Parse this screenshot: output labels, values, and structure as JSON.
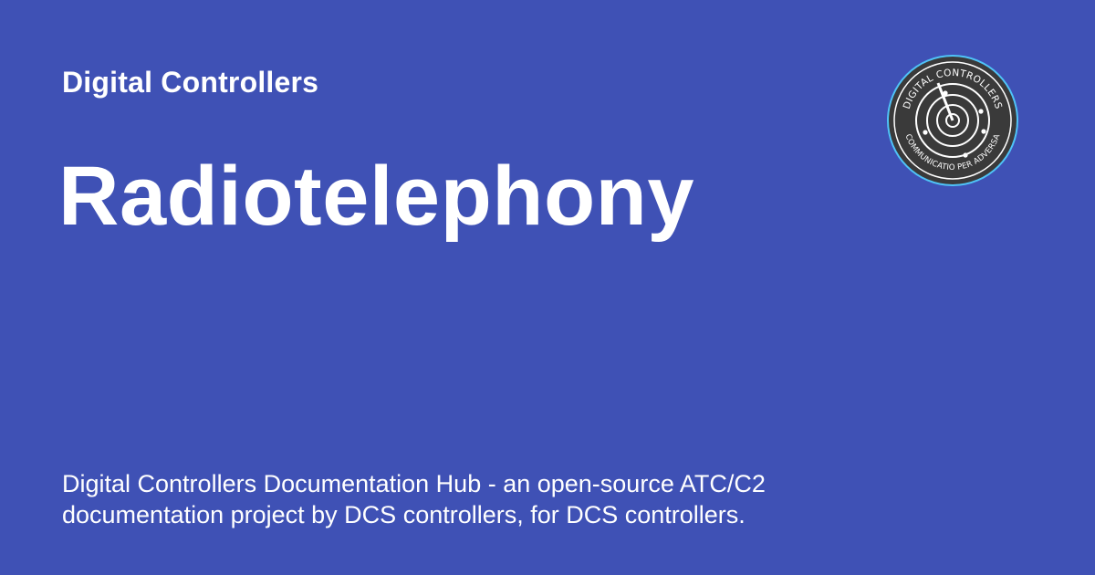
{
  "site": {
    "name": "Digital Controllers"
  },
  "page": {
    "title": "Radiotelephony",
    "description": "Digital Controllers Documentation Hub - an open-source ATC/C2 documentation project by DCS controllers, for DCS controllers."
  },
  "logo": {
    "top_text": "DIGITAL CONTROLLERS",
    "bottom_text": "COMMUNICATIO PER ADVERSA",
    "icon": "radar-scope-icon"
  },
  "colors": {
    "background": "#3f51b5",
    "text": "#ffffff",
    "logo_fill": "#3a3a3a",
    "logo_ring": "#4fc3f7"
  }
}
